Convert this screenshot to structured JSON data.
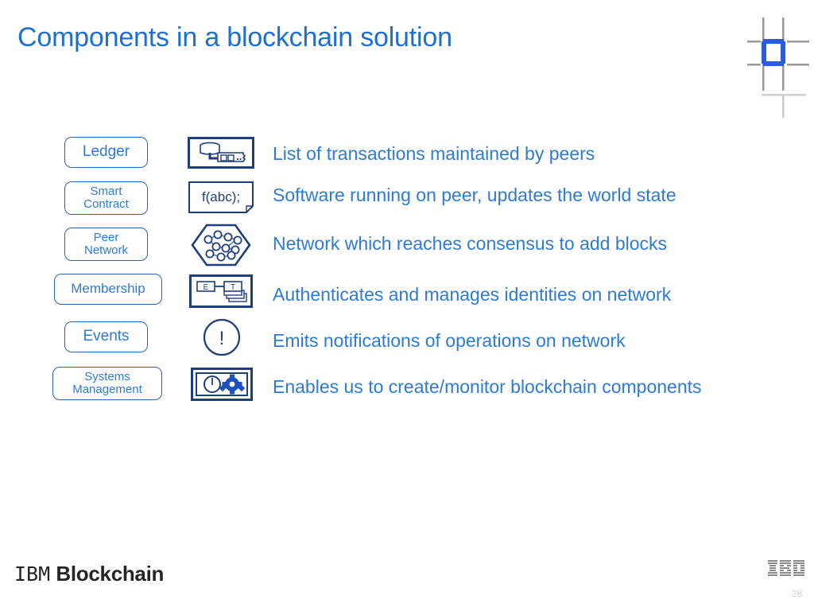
{
  "slide": {
    "title": "Components in a blockchain solution",
    "accent_blue": "#2d7bd6",
    "title_blue": "#1f6fd0",
    "icon_navy": "#1f3f7a",
    "mark_blue": "#2a5ce0",
    "mark_gray": "#9a9a9a"
  },
  "rows": [
    {
      "label_lines": [
        "Ledger"
      ],
      "icon_name": "ledger-icon",
      "icon_caption": "",
      "description": "List of transactions maintained by peers"
    },
    {
      "label_lines": [
        "Smart",
        "Contract"
      ],
      "icon_name": "smart-contract-icon",
      "icon_caption": "f(abc);",
      "description": "Software running on peer, updates the world state"
    },
    {
      "label_lines": [
        "Peer",
        "Network"
      ],
      "icon_name": "peer-network-icon",
      "icon_caption": "",
      "description": "Network which reaches consensus to add blocks"
    },
    {
      "label_lines": [
        "Membership"
      ],
      "icon_name": "membership-icon",
      "icon_caption": "",
      "description": "Authenticates and manages identities on network"
    },
    {
      "label_lines": [
        "Events"
      ],
      "icon_name": "events-icon",
      "icon_caption": "",
      "description": "Emits notifications of operations on network"
    },
    {
      "label_lines": [
        "Systems",
        "Management"
      ],
      "icon_name": "systems-management-icon",
      "icon_caption": "",
      "description": "Enables us to create/monitor blockchain components"
    }
  ],
  "footer": {
    "logo_ibm": "IBM",
    "logo_product": "Blockchain",
    "page_number": "28"
  },
  "icon_text": {
    "membership_e": "E",
    "membership_t": "T",
    "events_bang": "!"
  }
}
